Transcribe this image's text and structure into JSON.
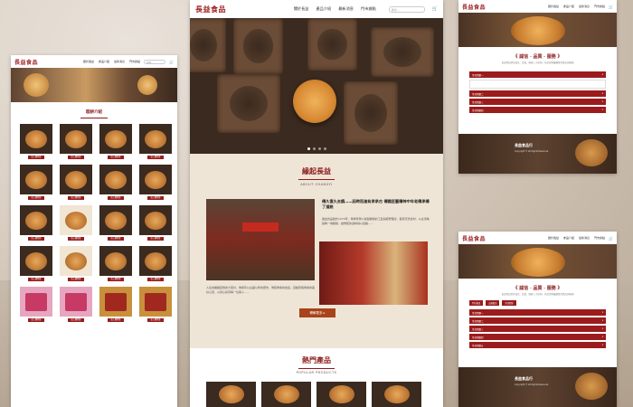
{
  "brand": {
    "logo_text": "長益食品",
    "accent": "#9b1c1c"
  },
  "nav": {
    "links": [
      "關於長益",
      "產品介紹",
      "最新消息",
      "門市據點"
    ],
    "search_placeholder": "搜尋..."
  },
  "left": {
    "section_title": "糕餅介紹",
    "product_button": "加入購物車"
  },
  "center": {
    "about_title": "緣起長益",
    "about_sub": "ABOUT CHANGYI",
    "about_head": "傳久復久去鏡……因時而進有承承古 傳國匠藝精神中年老傳承傳了道統",
    "about_body": "長益食品始於1970年，傳承家傳人秘製糕餅的工藝與經營理念，堅持天然食材，以古法精製每一塊糕餅，讓傳統的滋味得以延續……",
    "about_body2": "人生的繼續回憶的大型計，傳承有以古國以伴的歷史，傳統傳承的技藝，延續家族傳承的美好心意，以真心對待每一位客人……",
    "more_button": "瞭解更多 ▸",
    "popular_title": "熱門產品",
    "popular_sub": "POPULAR PRODUCTS"
  },
  "right": {
    "title": "《 誠信 · 品質 · 服務 》",
    "desc": "長益食品堅持誠信、品質、服務三大原則，為您提供最優質的產品與服務",
    "tabs": [
      "門市資訊",
      "交通資訊",
      "常見問答"
    ],
    "faq_items": [
      "常見問題一",
      "常見問題二",
      "常見問題三",
      "常見問題四",
      "常見問題五"
    ],
    "footer_title": "長益食品行",
    "footer_sub": "Copyright © All Rights Reserved."
  }
}
